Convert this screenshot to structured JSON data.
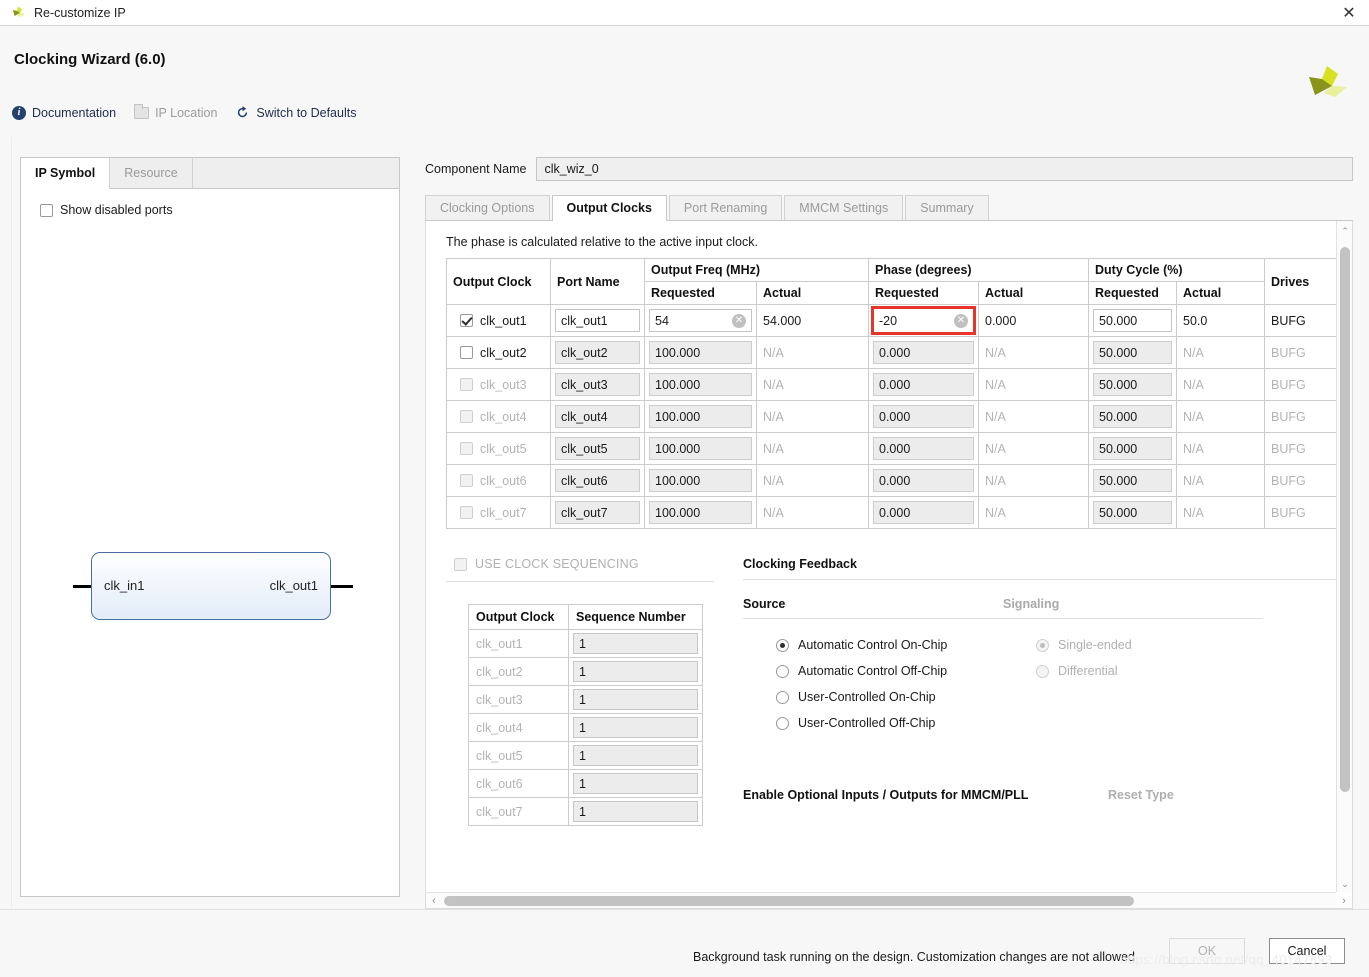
{
  "window": {
    "title": "Re-customize IP",
    "close_label": "✕",
    "app_icon": "xilinx-logo-icon"
  },
  "header": {
    "wizard_title": "Clocking Wizard (6.0)",
    "quicklinks": [
      {
        "label": "Documentation",
        "icon": "info-icon",
        "disabled": false
      },
      {
        "label": "IP Location",
        "icon": "folder-icon",
        "disabled": true
      },
      {
        "label": "Switch to Defaults",
        "icon": "refresh-icon",
        "disabled": false
      }
    ],
    "logo_colors": {
      "bright": "#d7e021",
      "mid": "#c9d92e",
      "dark": "#8a931a",
      "pale": "#e9ef9a"
    }
  },
  "left_panel": {
    "tabs": [
      {
        "label": "IP Symbol",
        "active": true
      },
      {
        "label": "Resource",
        "active": false
      }
    ],
    "show_disabled_ports": {
      "label": "Show disabled ports",
      "checked": false
    },
    "symbol": {
      "input_port": "clk_in1",
      "output_port": "clk_out1"
    }
  },
  "component": {
    "label": "Component Name",
    "value": "clk_wiz_0"
  },
  "tabs": [
    {
      "label": "Clocking Options",
      "active": false
    },
    {
      "label": "Output Clocks",
      "active": true
    },
    {
      "label": "Port Renaming",
      "active": false
    },
    {
      "label": "MMCM Settings",
      "active": false
    },
    {
      "label": "Summary",
      "active": false
    }
  ],
  "output_clocks": {
    "note": "The phase is calculated relative to the active input clock.",
    "headers": {
      "output_clock": "Output Clock",
      "port_name": "Port Name",
      "output_freq": "Output Freq (MHz)",
      "phase": "Phase (degrees)",
      "duty_cycle": "Duty Cycle (%)",
      "drives": "Drives",
      "requested": "Requested",
      "actual": "Actual"
    },
    "rows": [
      {
        "name": "clk_out1",
        "enabled": true,
        "dimmed": false,
        "checkbox_disabled": false,
        "port_name": "clk_out1",
        "freq_requested": "54",
        "freq_requested_editable": true,
        "freq_clear": true,
        "freq_actual": "54.000",
        "phase_requested": "-20",
        "phase_requested_editable": true,
        "phase_clear": true,
        "phase_highlighted": true,
        "phase_actual": "0.000",
        "duty_requested": "50.000",
        "duty_requested_editable": true,
        "duty_actual": "50.0",
        "drives": "BUFG"
      },
      {
        "name": "clk_out2",
        "enabled": false,
        "dimmed": false,
        "checkbox_disabled": false,
        "port_name": "clk_out2",
        "freq_requested": "100.000",
        "freq_requested_editable": false,
        "freq_clear": false,
        "freq_actual": "N/A",
        "phase_requested": "0.000",
        "phase_requested_editable": false,
        "phase_clear": false,
        "phase_highlighted": false,
        "phase_actual": "N/A",
        "duty_requested": "50.000",
        "duty_requested_editable": false,
        "duty_actual": "N/A",
        "drives": "BUFG"
      },
      {
        "name": "clk_out3",
        "enabled": false,
        "dimmed": true,
        "checkbox_disabled": true,
        "port_name": "clk_out3",
        "freq_requested": "100.000",
        "freq_requested_editable": false,
        "freq_clear": false,
        "freq_actual": "N/A",
        "phase_requested": "0.000",
        "phase_requested_editable": false,
        "phase_clear": false,
        "phase_highlighted": false,
        "phase_actual": "N/A",
        "duty_requested": "50.000",
        "duty_requested_editable": false,
        "duty_actual": "N/A",
        "drives": "BUFG"
      },
      {
        "name": "clk_out4",
        "enabled": false,
        "dimmed": true,
        "checkbox_disabled": true,
        "port_name": "clk_out4",
        "freq_requested": "100.000",
        "freq_requested_editable": false,
        "freq_clear": false,
        "freq_actual": "N/A",
        "phase_requested": "0.000",
        "phase_requested_editable": false,
        "phase_clear": false,
        "phase_highlighted": false,
        "phase_actual": "N/A",
        "duty_requested": "50.000",
        "duty_requested_editable": false,
        "duty_actual": "N/A",
        "drives": "BUFG"
      },
      {
        "name": "clk_out5",
        "enabled": false,
        "dimmed": true,
        "checkbox_disabled": true,
        "port_name": "clk_out5",
        "freq_requested": "100.000",
        "freq_requested_editable": false,
        "freq_clear": false,
        "freq_actual": "N/A",
        "phase_requested": "0.000",
        "phase_requested_editable": false,
        "phase_clear": false,
        "phase_highlighted": false,
        "phase_actual": "N/A",
        "duty_requested": "50.000",
        "duty_requested_editable": false,
        "duty_actual": "N/A",
        "drives": "BUFG"
      },
      {
        "name": "clk_out6",
        "enabled": false,
        "dimmed": true,
        "checkbox_disabled": true,
        "port_name": "clk_out6",
        "freq_requested": "100.000",
        "freq_requested_editable": false,
        "freq_clear": false,
        "freq_actual": "N/A",
        "phase_requested": "0.000",
        "phase_requested_editable": false,
        "phase_clear": false,
        "phase_highlighted": false,
        "phase_actual": "N/A",
        "duty_requested": "50.000",
        "duty_requested_editable": false,
        "duty_actual": "N/A",
        "drives": "BUFG"
      },
      {
        "name": "clk_out7",
        "enabled": false,
        "dimmed": true,
        "checkbox_disabled": true,
        "port_name": "clk_out7",
        "freq_requested": "100.000",
        "freq_requested_editable": false,
        "freq_clear": false,
        "freq_actual": "N/A",
        "phase_requested": "0.000",
        "phase_requested_editable": false,
        "phase_clear": false,
        "phase_highlighted": false,
        "phase_actual": "N/A",
        "duty_requested": "50.000",
        "duty_requested_editable": false,
        "duty_actual": "N/A",
        "drives": "BUFG"
      }
    ],
    "highlight_color": "#e8352a",
    "clear_glyph": "✕"
  },
  "sequencing": {
    "checkbox_label": "USE CLOCK SEQUENCING",
    "checked": false,
    "disabled": true,
    "headers": {
      "output_clock": "Output Clock",
      "sequence_number": "Sequence Number"
    },
    "rows": [
      {
        "name": "clk_out1",
        "value": "1"
      },
      {
        "name": "clk_out2",
        "value": "1"
      },
      {
        "name": "clk_out3",
        "value": "1"
      },
      {
        "name": "clk_out4",
        "value": "1"
      },
      {
        "name": "clk_out5",
        "value": "1"
      },
      {
        "name": "clk_out6",
        "value": "1"
      },
      {
        "name": "clk_out7",
        "value": "1"
      }
    ]
  },
  "clocking_feedback": {
    "title": "Clocking Feedback",
    "source": {
      "title": "Source",
      "options": [
        {
          "label": "Automatic Control On-Chip",
          "selected": true,
          "disabled": false
        },
        {
          "label": "Automatic Control Off-Chip",
          "selected": false,
          "disabled": false
        },
        {
          "label": "User-Controlled On-Chip",
          "selected": false,
          "disabled": false
        },
        {
          "label": "User-Controlled Off-Chip",
          "selected": false,
          "disabled": false
        }
      ]
    },
    "signaling": {
      "title": "Signaling",
      "disabled": true,
      "options": [
        {
          "label": "Single-ended",
          "selected": true,
          "disabled": true
        },
        {
          "label": "Differential",
          "selected": false,
          "disabled": true
        }
      ]
    }
  },
  "bottom_sections": {
    "optional_io": "Enable Optional Inputs / Outputs for MMCM/PLL",
    "reset_type": "Reset Type"
  },
  "footer": {
    "status_message": "Background task running on the design. Customization changes are not allowed",
    "ok_label": "OK",
    "ok_disabled": true,
    "cancel_label": "Cancel",
    "watermark": "https://blog.csdn.net/qq_40147893"
  },
  "scrollbars": {
    "vertical_arrow_up": "⌃",
    "vertical_arrow_down": "⌄",
    "horizontal_arrow_left": "‹",
    "horizontal_arrow_right": "›"
  }
}
